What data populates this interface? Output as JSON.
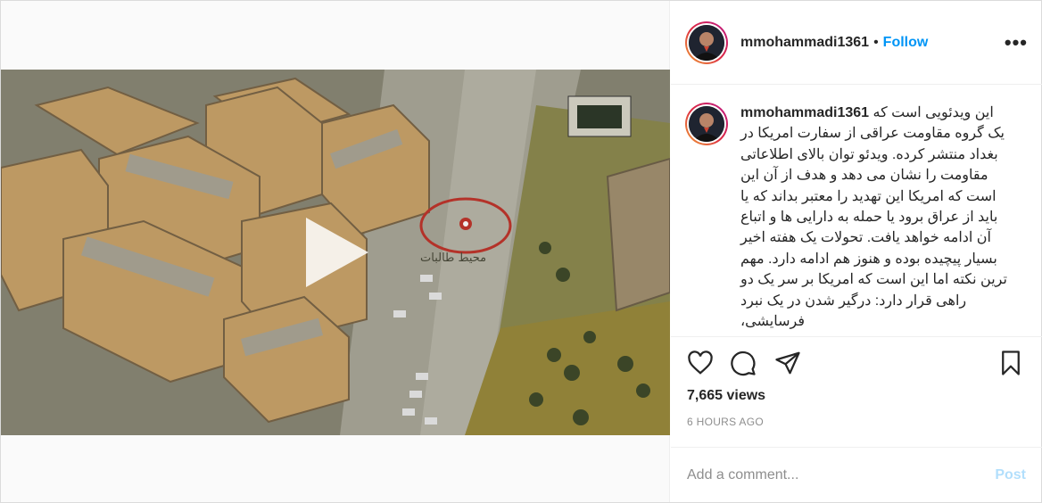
{
  "header": {
    "username": "mmohammadi1361",
    "separator": "•",
    "follow_label": "Follow",
    "more_label": "•••"
  },
  "caption": {
    "username": "mmohammadi1361",
    "text": "این ویدئویی است که یک گروه مقاومت عراقی از سفارت امریکا در بغداد منتشر کرده. ویدئو توان بالای اطلاعاتی مقاومت را نشان می دهد و هدف از آن این است که امریکا این تهدید را معتبر بداند که یا باید از عراق برود یا حمله به دارایی ها و اتباع آن ادامه خواهد یافت. تحولات یک هفته اخیر بسیار پیچیده بوده و هنوز هم ادامه دارد. مهم ترین نکته اما این است که امریکا بر سر یک دو راهی قرار دارد: درگیر شدن در یک نبرد فرسایشی،"
  },
  "video": {
    "overlay_text": "محیط طالبات"
  },
  "actions": {
    "like_icon": "heart-icon",
    "comment_icon": "comment-icon",
    "share_icon": "paper-plane-icon",
    "save_icon": "bookmark-icon"
  },
  "stats": {
    "views": "7,665 views",
    "time": "6 HOURS AGO"
  },
  "comment_box": {
    "placeholder": "Add a comment...",
    "post_label": "Post"
  },
  "colors": {
    "accent": "#0095f6",
    "post_disabled": "#b2dffc",
    "muted": "#8e8e8e"
  }
}
